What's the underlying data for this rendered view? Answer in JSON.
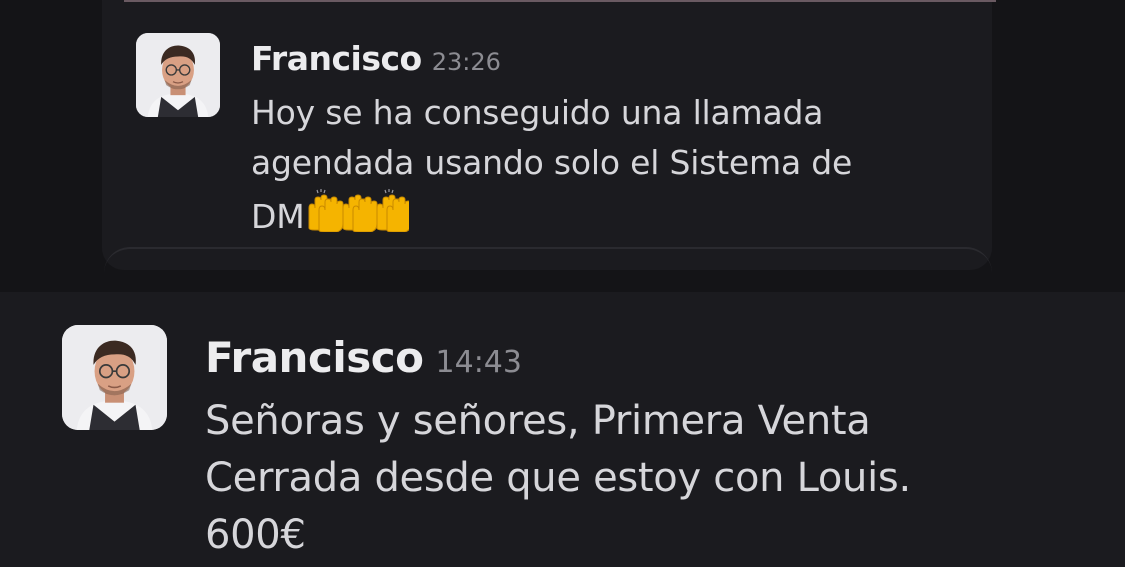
{
  "messages": [
    {
      "author": "Francisco",
      "time": "23:26",
      "lines": [
        "Hoy se ha conseguido una llamada",
        "agendada usando solo el Sistema de",
        "DM"
      ],
      "emoji": [
        "raising-hands-icon",
        "raising-hands-icon",
        "raising-hands-icon"
      ]
    },
    {
      "author": "Francisco",
      "time": "14:43",
      "lines": [
        "Señoras y señores, Primera Venta",
        "Cerrada desde que estoy con Louis.",
        "600€"
      ]
    }
  ],
  "colors": {
    "background": "#141417",
    "message_background": "#1b1b1f",
    "name": "#ececee",
    "text": "#d6d6da",
    "timestamp": "#8c8c92",
    "emoji": "#f5b400"
  }
}
